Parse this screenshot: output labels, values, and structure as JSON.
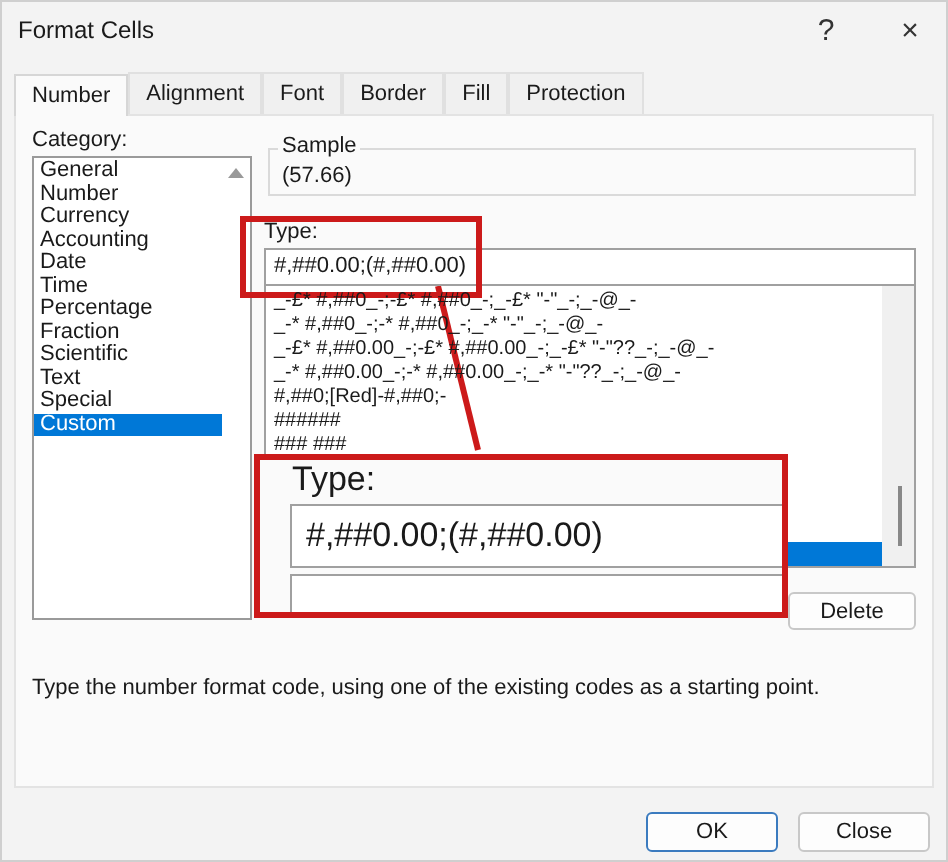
{
  "window": {
    "title": "Format Cells",
    "help": "?",
    "close": "×"
  },
  "tabs": [
    {
      "label": "Number",
      "selected": true
    },
    {
      "label": "Alignment",
      "selected": false
    },
    {
      "label": "Font",
      "selected": false
    },
    {
      "label": "Border",
      "selected": false
    },
    {
      "label": "Fill",
      "selected": false
    },
    {
      "label": "Protection",
      "selected": false
    }
  ],
  "category": {
    "label": "Category:",
    "items": [
      {
        "label": "General",
        "selected": false
      },
      {
        "label": "Number",
        "selected": false
      },
      {
        "label": "Currency",
        "selected": false
      },
      {
        "label": "Accounting",
        "selected": false
      },
      {
        "label": "Date",
        "selected": false
      },
      {
        "label": "Time",
        "selected": false
      },
      {
        "label": "Percentage",
        "selected": false
      },
      {
        "label": "Fraction",
        "selected": false
      },
      {
        "label": "Scientific",
        "selected": false
      },
      {
        "label": "Text",
        "selected": false
      },
      {
        "label": "Special",
        "selected": false
      },
      {
        "label": "Custom",
        "selected": true
      }
    ]
  },
  "sample": {
    "label": "Sample",
    "value": "(57.66)"
  },
  "type": {
    "label": "Type:",
    "value": "#,##0.00;(#,##0.00)"
  },
  "formats": [
    {
      "label": "_-£* #,##0_-;-£* #,##0_-;_-£* \"-\"_-;_-@_-",
      "selected": false
    },
    {
      "label": "_-* #,##0_-;-* #,##0_-;_-* \"-\"_-;_-@_-",
      "selected": false
    },
    {
      "label": "_-£* #,##0.00_-;-£* #,##0.00_-;_-£* \"-\"??_-;_-@_-",
      "selected": false
    },
    {
      "label": "_-* #,##0.00_-;-* #,##0.00_-;_-* \"-\"??_-;_-@_-",
      "selected": false
    },
    {
      "label": "#,##0;[Red]-#,##0;-",
      "selected": false
    },
    {
      "label": "######",
      "selected": false
    },
    {
      "label": "### ###",
      "selected": false
    },
    {
      "selected": true
    }
  ],
  "delete_button": "Delete",
  "description": "Type the number format code, using one of the existing codes as a starting point.",
  "buttons": [
    "OK",
    "Close"
  ],
  "callout": {
    "label": "Type:",
    "value": "#,##0.00;(#,##0.00)"
  }
}
